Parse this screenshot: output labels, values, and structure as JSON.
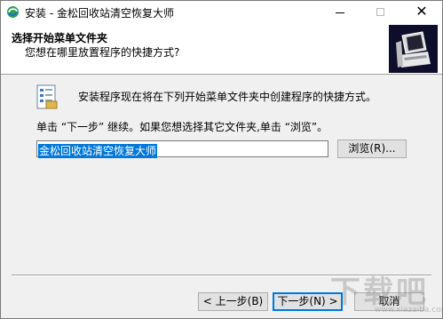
{
  "window": {
    "title": "安装 - 金松回收站清空恢复大师",
    "icon": "app-swirl-icon",
    "controls": {
      "minimize": "minimize-icon",
      "maximize": "maximize-icon",
      "close": "close-icon",
      "close_glyph": "✕"
    }
  },
  "header": {
    "title": "选择开始菜单文件夹",
    "subtitle": "您想在哪里放置程序的快捷方式?",
    "logo_icon": "computer-box-icon"
  },
  "body": {
    "folder_icon": "start-menu-folder-icon",
    "intro": "安装程序现在将在下列开始菜单文件夹中创建程序的快捷方式。",
    "instruction": "单击 “下一步” 继续。如果您想选择其它文件夹,单击 “浏览”。",
    "folder_value": "金松回收站清空恢复大师",
    "browse_label": "浏览(R)..."
  },
  "footer": {
    "back_label": "< 上一步(B)",
    "next_label": "下一步(N) >",
    "cancel_label": "取消"
  },
  "watermark": {
    "text": "下载吧",
    "url": "www.xiazaiba.com"
  },
  "colors": {
    "accent": "#0078d7",
    "selection": "#0078d7",
    "header_bg": "#ffffff",
    "dialog_bg": "#f0f0f0",
    "logo_bg": "#0e0e2a"
  }
}
